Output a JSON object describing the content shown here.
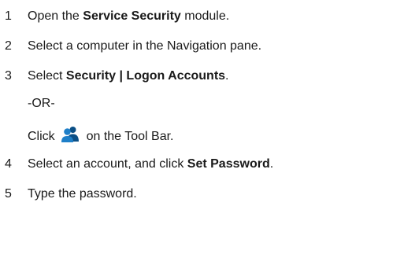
{
  "steps": [
    {
      "num": "1",
      "pre": "Open the ",
      "bold": "Service Security",
      "post": " module."
    },
    {
      "num": "2",
      "text": "Select a computer in the Navigation pane."
    },
    {
      "num": "3",
      "pre": "Select ",
      "bold": "Security | Logon Accounts",
      "post": "."
    },
    {
      "num": "4",
      "pre": "Select an account, and click ",
      "bold": "Set Password",
      "post": "."
    },
    {
      "num": "5",
      "text": "Type the password."
    }
  ],
  "alt": {
    "or": "-OR-",
    "click_pre": "Click",
    "click_post": "on the Tool Bar.",
    "icon": "logon-accounts-users-icon"
  },
  "colors": {
    "text": "#1a1a1a",
    "icon_blue": "#1e7fc8",
    "icon_dark": "#0b4f86"
  }
}
